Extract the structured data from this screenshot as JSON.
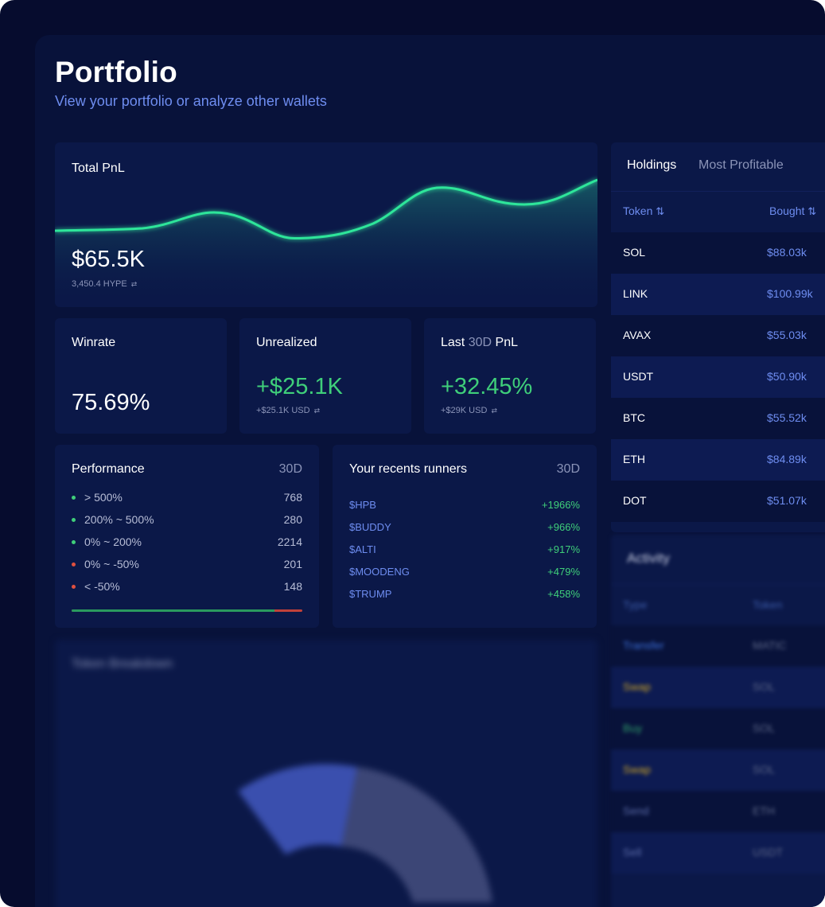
{
  "header": {
    "title": "Portfolio",
    "subtitle": "View your portfolio or analyze other wallets"
  },
  "total_pnl": {
    "label": "Total PnL",
    "value": "$65.5K",
    "sub": "3,450.4 HYPE"
  },
  "winrate": {
    "label": "Winrate",
    "value": "75.69%"
  },
  "unrealized": {
    "label": "Unrealized",
    "value": "+$25.1K",
    "sub": "+$25.1K USD"
  },
  "last_pnl": {
    "label_pre": "Last",
    "label_period": "30D",
    "label_post": "PnL",
    "value": "+32.45%",
    "sub": "+$29K USD"
  },
  "performance": {
    "label": "Performance",
    "period": "30D",
    "rows": [
      {
        "label": "> 500%",
        "count": "768",
        "color": "#3fcf7a"
      },
      {
        "label": "200% ~ 500%",
        "count": "280",
        "color": "#3fcf7a"
      },
      {
        "label": "0% ~ 200%",
        "count": "2214",
        "color": "#3fcf7a"
      },
      {
        "label": "0% ~ -50%",
        "count": "201",
        "color": "#e0503f"
      },
      {
        "label": "< -50%",
        "count": "148",
        "color": "#e0503f"
      }
    ],
    "win_fraction": 0.88
  },
  "runners": {
    "label": "Your recents runners",
    "period": "30D",
    "rows": [
      {
        "token": "$HPB",
        "pct": "+1966%"
      },
      {
        "token": "$BUDDY",
        "pct": "+966%"
      },
      {
        "token": "$ALTI",
        "pct": "+917%"
      },
      {
        "token": "$MOODENG",
        "pct": "+479%"
      },
      {
        "token": "$TRUMP",
        "pct": "+458%"
      }
    ]
  },
  "breakdown": {
    "label": "Token Breakdown"
  },
  "holdings": {
    "tabs": [
      "Holdings",
      "Most Profitable"
    ],
    "columns": [
      "Token",
      "Bought"
    ],
    "rows": [
      {
        "token": "SOL",
        "bought": "$88.03k"
      },
      {
        "token": "LINK",
        "bought": "$100.99k"
      },
      {
        "token": "AVAX",
        "bought": "$55.03k"
      },
      {
        "token": "USDT",
        "bought": "$50.90k"
      },
      {
        "token": "BTC",
        "bought": "$55.52k"
      },
      {
        "token": "ETH",
        "bought": "$84.89k"
      },
      {
        "token": "DOT",
        "bought": "$51.07k"
      }
    ]
  },
  "activity": {
    "label": "Activity",
    "columns": [
      "Type",
      "Token"
    ],
    "rows": [
      {
        "type": "Transfer",
        "token": "MATIC",
        "color": "#3b6ed8"
      },
      {
        "type": "Swap",
        "token": "SOL",
        "color": "#c9a227"
      },
      {
        "type": "Buy",
        "token": "SOL",
        "color": "#2f9e6a"
      },
      {
        "type": "Swap",
        "token": "SOL",
        "color": "#c9a227"
      },
      {
        "type": "Send",
        "token": "ETH",
        "color": "#5a6aa8"
      },
      {
        "type": "Sell",
        "token": "USDT",
        "color": "#5a6aa8"
      }
    ]
  },
  "colors": {
    "background": "#060c2e",
    "panel": "#0b1848",
    "accent": "#6e8df0",
    "positive": "#3fcf7a",
    "negative": "#e0503f",
    "chart_line": "#2ee59a"
  }
}
